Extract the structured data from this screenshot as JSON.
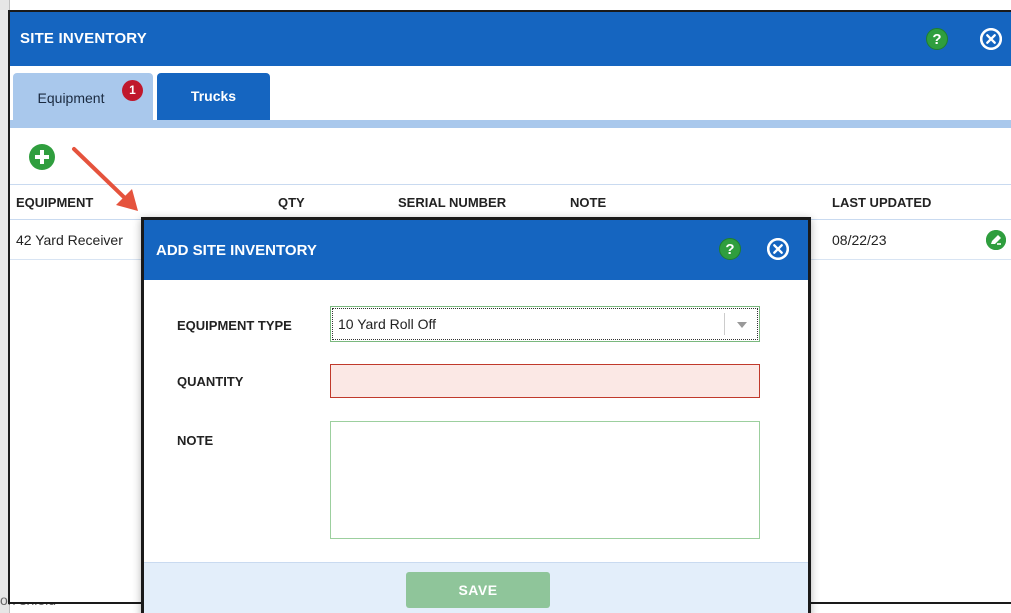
{
  "backdrop": {
    "partial_text": "on shield"
  },
  "main": {
    "title": "SITE INVENTORY",
    "help_label": "?",
    "tabs": [
      {
        "label": "Equipment",
        "badge": "1"
      },
      {
        "label": "Trucks"
      }
    ],
    "table": {
      "headers": [
        "EQUIPMENT",
        "QTY",
        "SERIAL NUMBER",
        "NOTE",
        "LAST UPDATED"
      ],
      "rows": [
        {
          "equipment": "42 Yard Receiver",
          "last_updated": "08/22/23"
        }
      ]
    }
  },
  "dialog": {
    "title": "ADD SITE INVENTORY",
    "help_label": "?",
    "labels": {
      "equipment_type": "EQUIPMENT TYPE",
      "quantity": "QUANTITY",
      "note": "NOTE"
    },
    "equipment_type_value": "10 Yard Roll Off",
    "quantity_value": "",
    "note_value": "",
    "save_label": "SAVE"
  },
  "colors": {
    "header_blue": "#1565c0",
    "tab_light_blue": "#a9c8ec",
    "help_green": "#2f9e3e",
    "badge_red": "#c0182c",
    "error_border": "#c0392b",
    "error_fill": "#fbe8e5",
    "save_disabled_green": "#8fc59a",
    "arrow_red": "#e5533d"
  },
  "icons": {
    "add": "plus-circle-icon",
    "help": "help-icon",
    "close": "close-icon",
    "row_edit": "edit-circle-icon",
    "dropdown": "chevron-down-icon"
  }
}
